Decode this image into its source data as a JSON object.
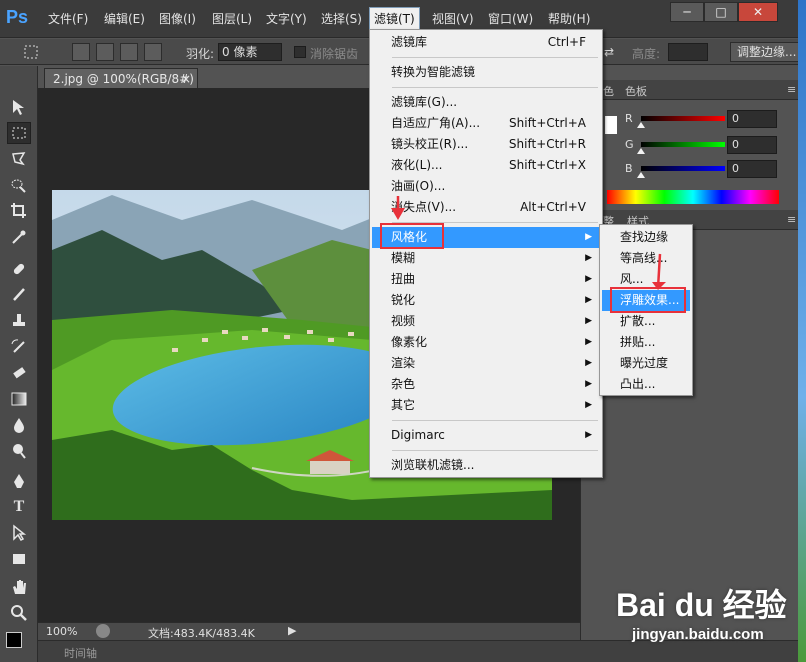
{
  "app": {
    "logo": "Ps"
  },
  "menubar": {
    "items": [
      "文件(F)",
      "编辑(E)",
      "图像(I)",
      "图层(L)",
      "文字(Y)",
      "选择(S)",
      "滤镜(T)",
      "视图(V)",
      "窗口(W)",
      "帮助(H)"
    ],
    "active_index": 6
  },
  "window_controls": {
    "minimize": "─",
    "maximize": "□",
    "close": "✕"
  },
  "options_bar": {
    "feather_label": "羽化:",
    "feather_value": "0 像素",
    "antialias_label": "消除锯齿",
    "height_label": "高度:",
    "refine_edge_button": "调整边缘..."
  },
  "document": {
    "tab_title": "2.jpg @ 100%(RGB/8#)",
    "tab_close": "×"
  },
  "status_bar": {
    "zoom": "100%",
    "doc_info": "文档:483.4K/483.4K"
  },
  "timeline": {
    "label": "时间轴"
  },
  "right_panel": {
    "tabs_top": [
      "色",
      "色板"
    ],
    "sliders": [
      {
        "label": "R",
        "value": "0",
        "gradient_end": "#ff0000"
      },
      {
        "label": "G",
        "value": "0",
        "gradient_end": "#00ff00"
      },
      {
        "label": "B",
        "value": "0",
        "gradient_end": "#0000ff"
      }
    ],
    "tabs_mid": [
      "整",
      "样式"
    ]
  },
  "filter_menu": {
    "items": [
      {
        "label": "滤镜库",
        "shortcut": "Ctrl+F"
      },
      {
        "separator": true
      },
      {
        "label": "转换为智能滤镜"
      },
      {
        "separator": true
      },
      {
        "label": "滤镜库(G)..."
      },
      {
        "label": "自适应广角(A)...",
        "shortcut": "Shift+Ctrl+A"
      },
      {
        "label": "镜头校正(R)...",
        "shortcut": "Shift+Ctrl+R"
      },
      {
        "label": "液化(L)...",
        "shortcut": "Shift+Ctrl+X"
      },
      {
        "label": "油画(O)..."
      },
      {
        "label": "消失点(V)...",
        "shortcut": "Alt+Ctrl+V"
      },
      {
        "separator": true
      },
      {
        "label": "风格化",
        "submenu": true,
        "highlighted": true
      },
      {
        "label": "模糊",
        "submenu": true
      },
      {
        "label": "扭曲",
        "submenu": true
      },
      {
        "label": "锐化",
        "submenu": true
      },
      {
        "label": "视频",
        "submenu": true
      },
      {
        "label": "像素化",
        "submenu": true
      },
      {
        "label": "渲染",
        "submenu": true
      },
      {
        "label": "杂色",
        "submenu": true
      },
      {
        "label": "其它",
        "submenu": true
      },
      {
        "separator": true
      },
      {
        "label": "Digimarc",
        "submenu": true
      },
      {
        "separator": true
      },
      {
        "label": "浏览联机滤镜..."
      }
    ]
  },
  "stylize_submenu": {
    "items": [
      {
        "label": "查找边缘"
      },
      {
        "label": "等高线..."
      },
      {
        "label": "风..."
      },
      {
        "label": "浮雕效果...",
        "highlighted": true
      },
      {
        "label": "扩散..."
      },
      {
        "label": "拼贴..."
      },
      {
        "label": "曝光过度"
      },
      {
        "label": "凸出..."
      }
    ]
  },
  "watermark": {
    "logo": "Bai du 经验",
    "url": "jingyan.baidu.com"
  }
}
